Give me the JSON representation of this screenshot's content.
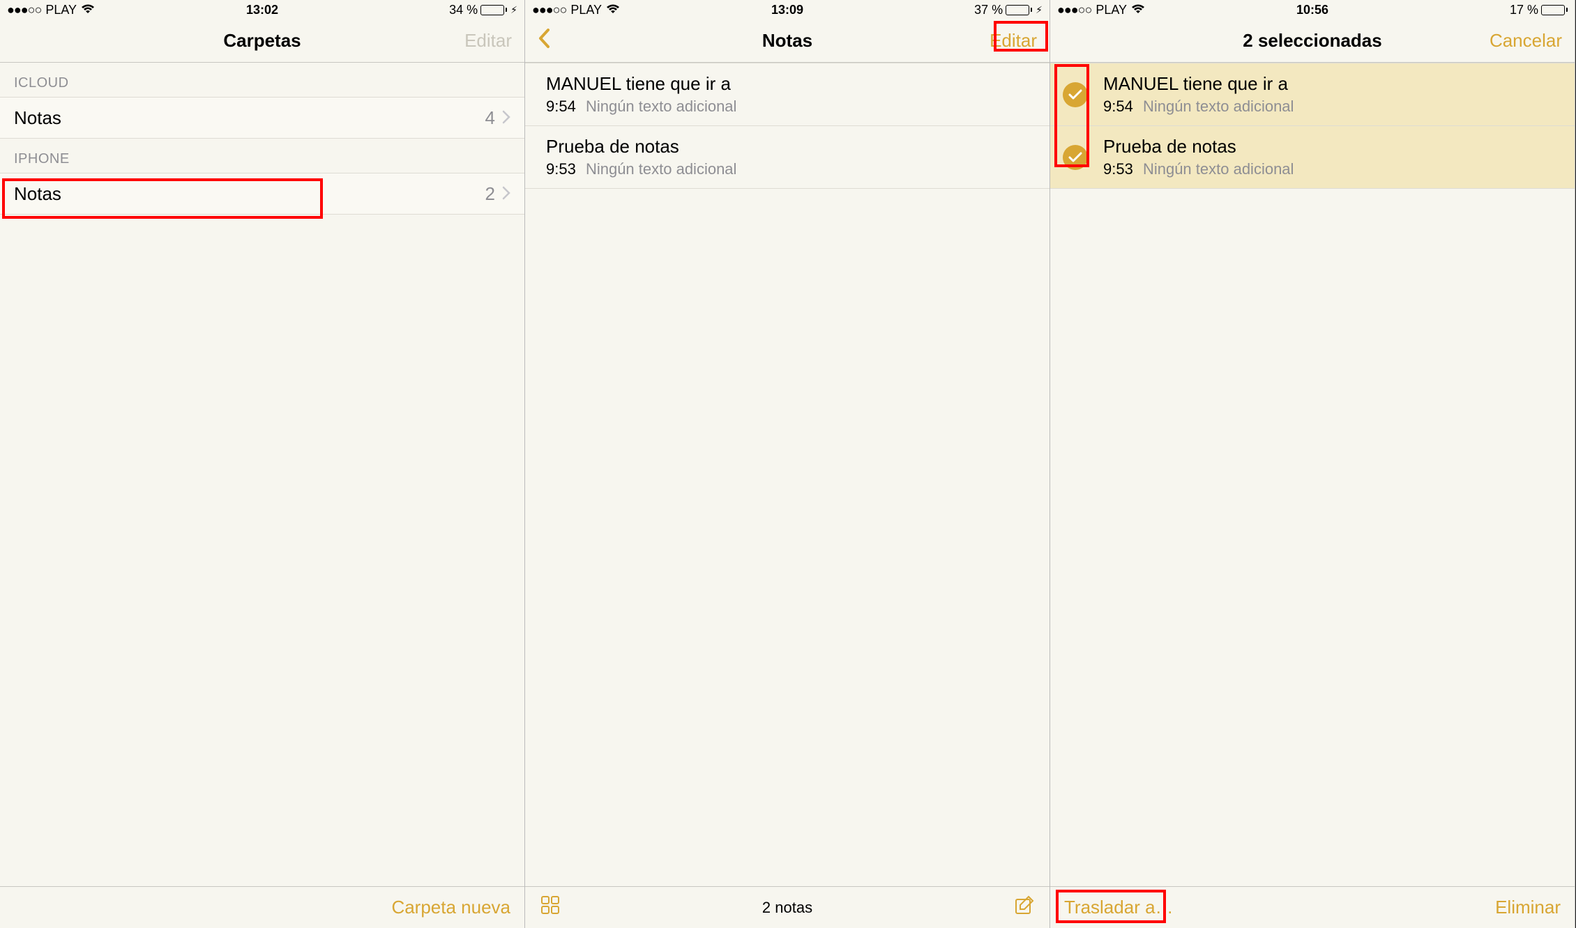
{
  "screen1": {
    "status": {
      "carrier": "PLAY",
      "dots": "●●●○○",
      "time": "13:02",
      "battery_pct": "34 %"
    },
    "nav": {
      "title": "Carpetas",
      "edit": "Editar"
    },
    "sections": {
      "icloud": {
        "header": "ICLOUD",
        "row": {
          "label": "Notas",
          "count": "4"
        }
      },
      "iphone": {
        "header": "IPHONE",
        "row": {
          "label": "Notas",
          "count": "2"
        }
      }
    },
    "toolbar": {
      "new_folder": "Carpeta nueva"
    }
  },
  "screen2": {
    "status": {
      "carrier": "PLAY",
      "dots": "●●●○○",
      "time": "13:09",
      "battery_pct": "37 %"
    },
    "nav": {
      "title": "Notas",
      "edit": "Editar"
    },
    "notes": [
      {
        "title": "MANUEL tiene que ir a",
        "time": "9:54",
        "extra": "Ningún texto adicional"
      },
      {
        "title": "Prueba de notas",
        "time": "9:53",
        "extra": "Ningún texto adicional"
      }
    ],
    "toolbar": {
      "count": "2 notas"
    }
  },
  "screen3": {
    "status": {
      "carrier": "PLAY",
      "dots": "●●●○○",
      "time": "10:56",
      "battery_pct": "17 %"
    },
    "nav": {
      "title": "2 seleccionadas",
      "cancel": "Cancelar"
    },
    "notes": [
      {
        "title": "MANUEL tiene que ir a",
        "time": "9:54",
        "extra": "Ningún texto adicional"
      },
      {
        "title": "Prueba de notas",
        "time": "9:53",
        "extra": "Ningún texto adicional"
      }
    ],
    "toolbar": {
      "move": "Trasladar a…",
      "delete": "Eliminar"
    }
  }
}
